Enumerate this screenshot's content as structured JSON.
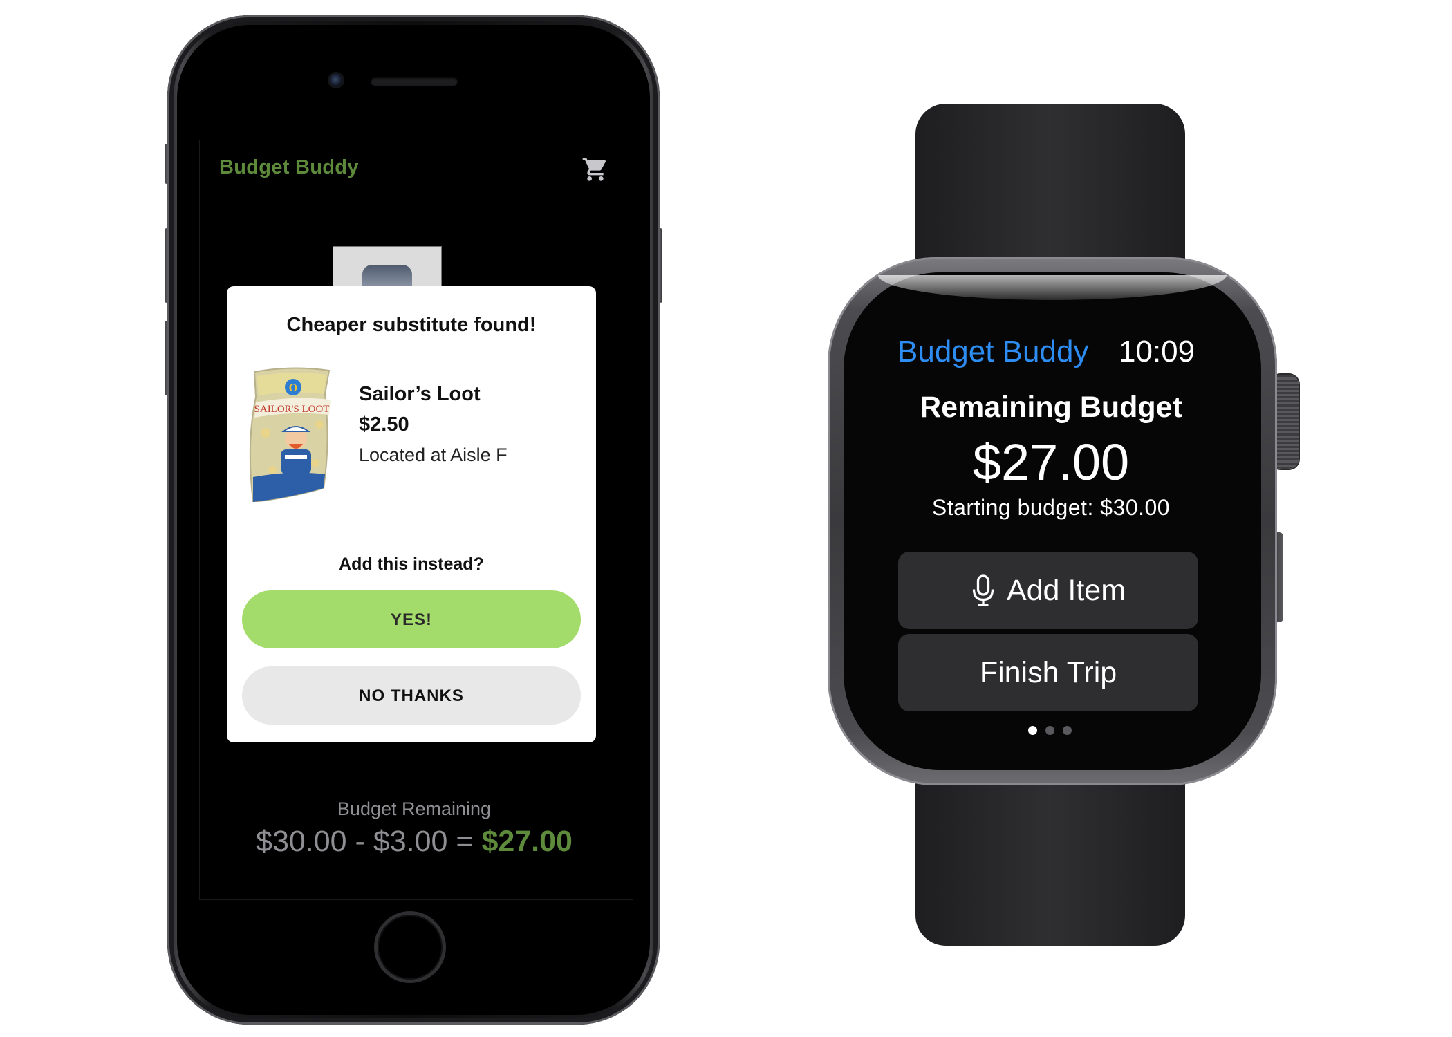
{
  "phone": {
    "app_title": "Budget Buddy",
    "header_icon": "shopping-cart-icon",
    "dialog": {
      "title": "Cheaper substitute found!",
      "product_name": "Sailor’s Loot",
      "product_price": "$2.50",
      "product_location": "Located at Aisle F",
      "question": "Add this instead?",
      "yes_label": "YES!",
      "no_label": "NO THANKS"
    },
    "budget": {
      "label": "Budget Remaining",
      "starting": "$30.00",
      "minus": "-",
      "spent": "$3.00",
      "equals": "=",
      "remaining": "$27.00"
    }
  },
  "watch": {
    "app_title": "Budget Buddy",
    "time": "10:09",
    "heading": "Remaining Budget",
    "amount": "$27.00",
    "starting_line": "Starting budget: $30.00",
    "buttons": [
      {
        "label": "Add Item",
        "icon": "microphone-icon"
      },
      {
        "label": "Finish Trip"
      }
    ],
    "page_dots": {
      "count": 3,
      "active_index": 0
    }
  },
  "colors": {
    "app_green": "#5e8a3c",
    "yes_button": "#a3dc6b",
    "watch_title_blue": "#2e8df2",
    "watch_button": "#2e2e31"
  }
}
